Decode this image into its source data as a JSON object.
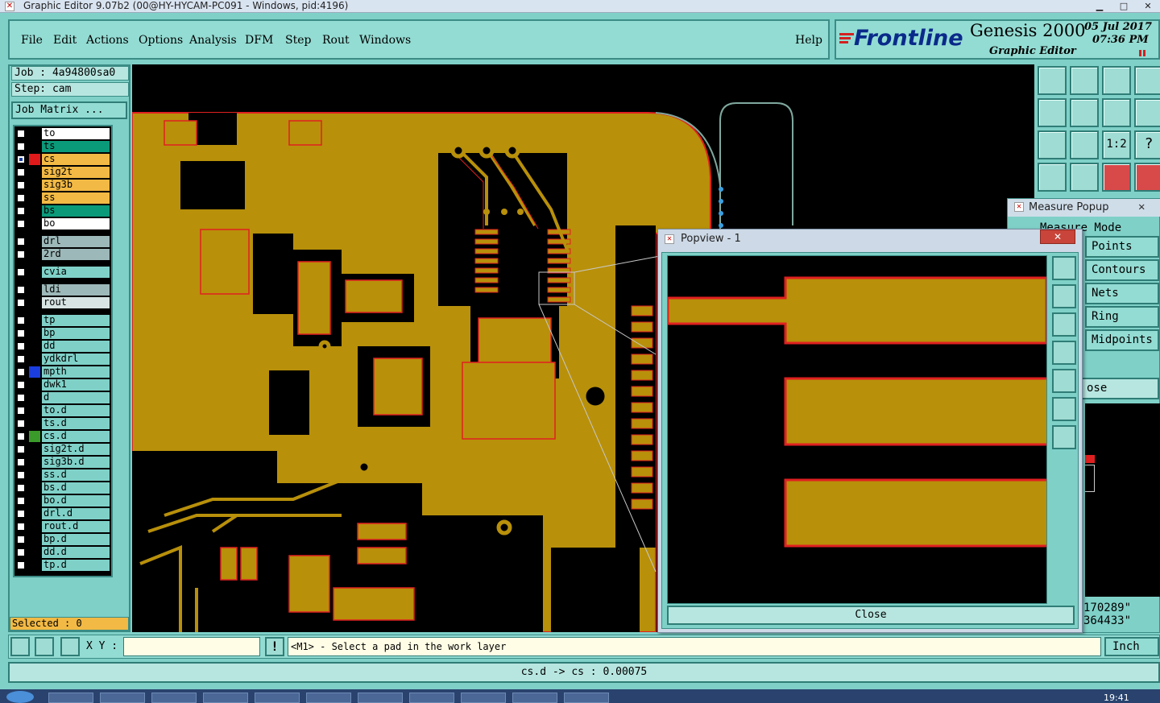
{
  "window": {
    "title": "Graphic Editor 9.07b2 (00@HY-HYCAM-PC091 - Windows, pid:4196)"
  },
  "menu": {
    "items": [
      "File",
      "Edit",
      "Actions",
      "Options",
      "Analysis",
      "DFM",
      "Step",
      "Rout",
      "Windows"
    ],
    "help": "Help"
  },
  "brand": {
    "logo": "Frontline",
    "product": "Genesis 2000",
    "subtitle": "Graphic Editor",
    "date": "05 Jul 2017",
    "time": "07:36 PM"
  },
  "job": {
    "job_label": "Job : 4a94800sa0",
    "step_label": "Step: cam",
    "matrix_button": "Job Matrix ..."
  },
  "layers": [
    {
      "name": "to",
      "color": "#ffffff"
    },
    {
      "name": "ts",
      "color": "#0a9a7a"
    },
    {
      "name": "cs",
      "color": "#f2b944",
      "swatch": "#e01a1a",
      "checked": true
    },
    {
      "name": "sig2t",
      "color": "#f2b944"
    },
    {
      "name": "sig3b",
      "color": "#f2b944"
    },
    {
      "name": "ss",
      "color": "#f2b944"
    },
    {
      "name": "bs",
      "color": "#0a9a7a"
    },
    {
      "name": "bo",
      "color": "#ffffff"
    },
    {
      "name": "drl",
      "color": "#9db8b9"
    },
    {
      "name": "2rd",
      "color": "#9db8b9"
    },
    {
      "name": "cvia",
      "color": "#7fd1c8"
    },
    {
      "name": "ldi",
      "color": "#9db8b9"
    },
    {
      "name": "rout",
      "color": "#d8e4e4"
    },
    {
      "name": "tp",
      "color": "#7fd1c8"
    },
    {
      "name": "bp",
      "color": "#7fd1c8"
    },
    {
      "name": "dd",
      "color": "#7fd1c8"
    },
    {
      "name": "ydkdrl",
      "color": "#7fd1c8"
    },
    {
      "name": "mpth",
      "color": "#7fd1c8",
      "swatch": "#1a3ee0"
    },
    {
      "name": "dwk1",
      "color": "#7fd1c8"
    },
    {
      "name": "d",
      "color": "#7fd1c8"
    },
    {
      "name": "to.d",
      "color": "#7fd1c8"
    },
    {
      "name": "ts.d",
      "color": "#7fd1c8"
    },
    {
      "name": "cs.d",
      "color": "#7fd1c8",
      "swatch": "#3a9a2a"
    },
    {
      "name": "sig2t.d",
      "color": "#7fd1c8"
    },
    {
      "name": "sig3b.d",
      "color": "#7fd1c8"
    },
    {
      "name": "ss.d",
      "color": "#7fd1c8"
    },
    {
      "name": "bs.d",
      "color": "#7fd1c8"
    },
    {
      "name": "bo.d",
      "color": "#7fd1c8"
    },
    {
      "name": "drl.d",
      "color": "#7fd1c8"
    },
    {
      "name": "rout.d",
      "color": "#7fd1c8"
    },
    {
      "name": "bp.d",
      "color": "#7fd1c8"
    },
    {
      "name": "dd.d",
      "color": "#7fd1c8"
    },
    {
      "name": "tp.d",
      "color": "#7fd1c8"
    }
  ],
  "selected": "Selected : 0",
  "measure": {
    "title": "Measure Popup",
    "mode_label": "Measure Mode",
    "buttons": [
      "Points",
      "Contours",
      "Nets",
      "Ring",
      "Midpoints"
    ],
    "close_partial": "ose",
    "value1": "170289\"",
    "value2": "364433\""
  },
  "popview": {
    "title": "Popview - 1",
    "close_button": "Close"
  },
  "command": {
    "xy_label": "X Y :",
    "xy_value": "",
    "prompt": "<M1> - Select a pad in the work layer",
    "units": "Inch"
  },
  "status": "cs.d -> cs : 0.00075",
  "taskbar": {
    "clock": "19:41"
  },
  "colors": {
    "copper": "#b8900a",
    "outline": "#e02020",
    "background": "#000000",
    "panel": "#7fd1c8"
  }
}
